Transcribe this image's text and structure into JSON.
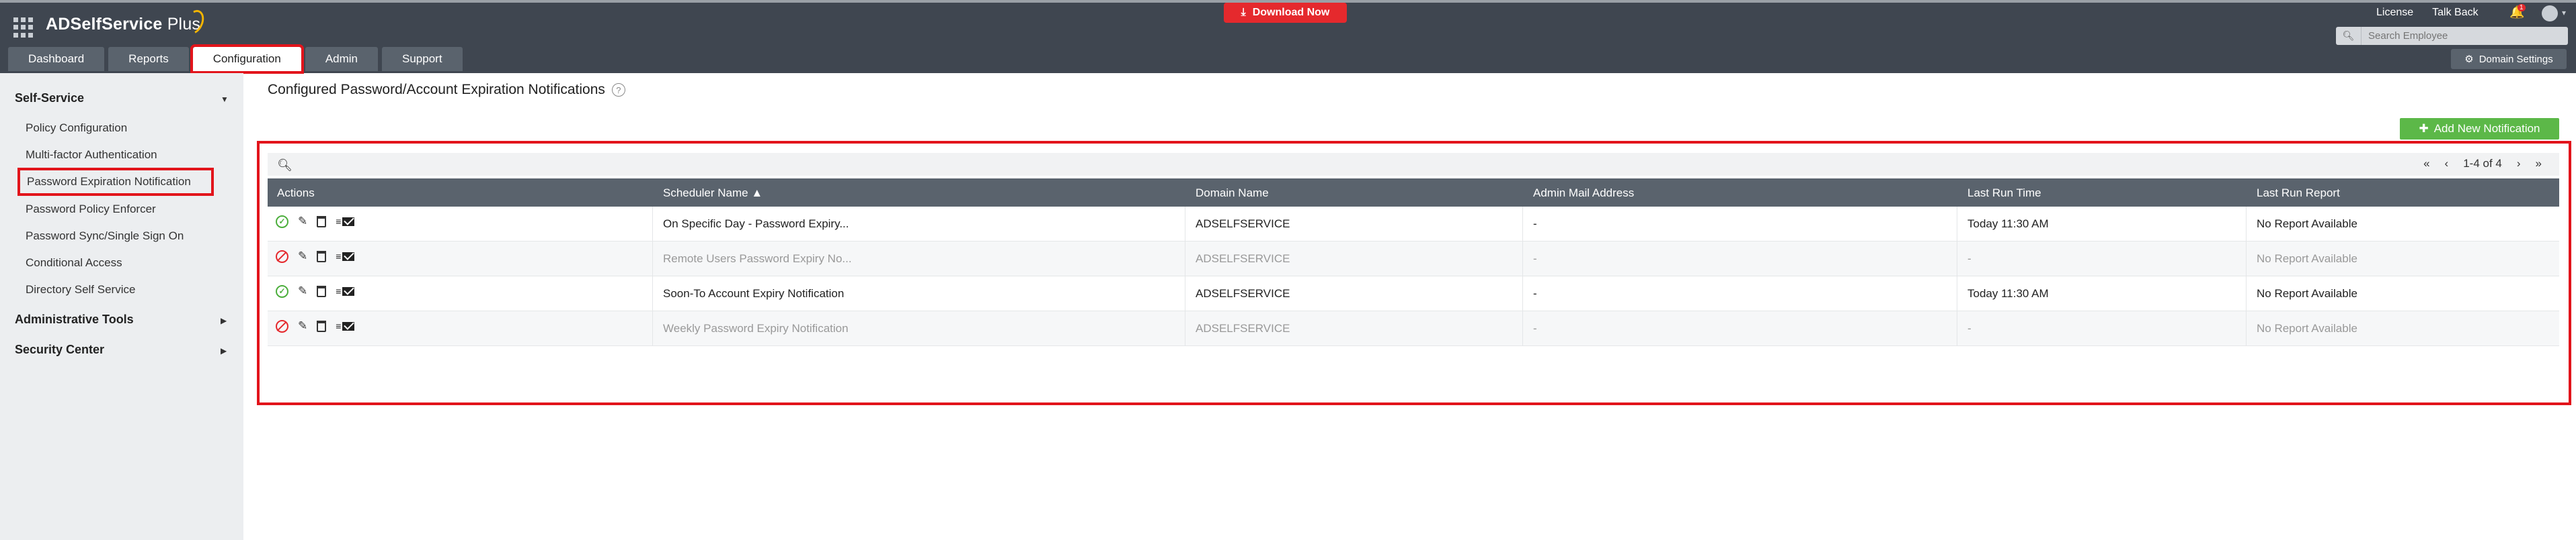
{
  "app": {
    "name": "ADSelfService",
    "name_suffix": "Plus"
  },
  "header": {
    "download_label": "Download Now",
    "links": [
      "License",
      "Talk Back"
    ],
    "notification_count": "1",
    "search_placeholder": "Search Employee",
    "domain_settings_label": "Domain Settings"
  },
  "tabs": [
    {
      "label": "Dashboard",
      "active": false
    },
    {
      "label": "Reports",
      "active": false
    },
    {
      "label": "Configuration",
      "active": true
    },
    {
      "label": "Admin",
      "active": false
    },
    {
      "label": "Support",
      "active": false
    }
  ],
  "sidebar": {
    "sections": [
      {
        "label": "Self-Service",
        "expanded": true
      },
      {
        "label": "Administrative Tools",
        "expanded": false
      },
      {
        "label": "Security Center",
        "expanded": false
      }
    ],
    "items": [
      {
        "label": "Policy Configuration"
      },
      {
        "label": "Multi-factor Authentication"
      },
      {
        "label": "Password Expiration Notification",
        "active": true
      },
      {
        "label": "Password Policy Enforcer"
      },
      {
        "label": "Password Sync/Single Sign On"
      },
      {
        "label": "Conditional Access"
      },
      {
        "label": "Directory Self Service"
      }
    ]
  },
  "main": {
    "title": "Configured Password/Account Expiration Notifications",
    "add_button_label": "Add New Notification",
    "pager": {
      "first": "«",
      "prev": "‹",
      "range": "1-4 of 4",
      "next": "›",
      "last": "»"
    },
    "columns": [
      "Actions",
      "Scheduler Name ▲",
      "Domain Name",
      "Admin Mail Address",
      "Last Run Time",
      "Last Run Report"
    ],
    "rows": [
      {
        "enabled": true,
        "scheduler": "On Specific Day - Password Expiry...",
        "domain": "ADSELFSERVICE",
        "admin_mail": "-",
        "last_run": "Today 11:30 AM",
        "report": "No Report Available"
      },
      {
        "enabled": false,
        "scheduler": "Remote Users Password Expiry No...",
        "domain": "ADSELFSERVICE",
        "admin_mail": "-",
        "last_run": "-",
        "report": "No Report Available"
      },
      {
        "enabled": true,
        "scheduler": "Soon-To Account Expiry Notification",
        "domain": "ADSELFSERVICE",
        "admin_mail": "-",
        "last_run": "Today 11:30 AM",
        "report": "No Report Available"
      },
      {
        "enabled": false,
        "scheduler": "Weekly Password Expiry Notification",
        "domain": "ADSELFSERVICE",
        "admin_mail": "-",
        "last_run": "-",
        "report": "No Report Available"
      }
    ]
  },
  "colors": {
    "accent_red": "#e2141b",
    "download_red": "#e5292d",
    "add_green": "#5cb848",
    "header_bg": "#3f4650",
    "table_head_bg": "#5a636d"
  }
}
